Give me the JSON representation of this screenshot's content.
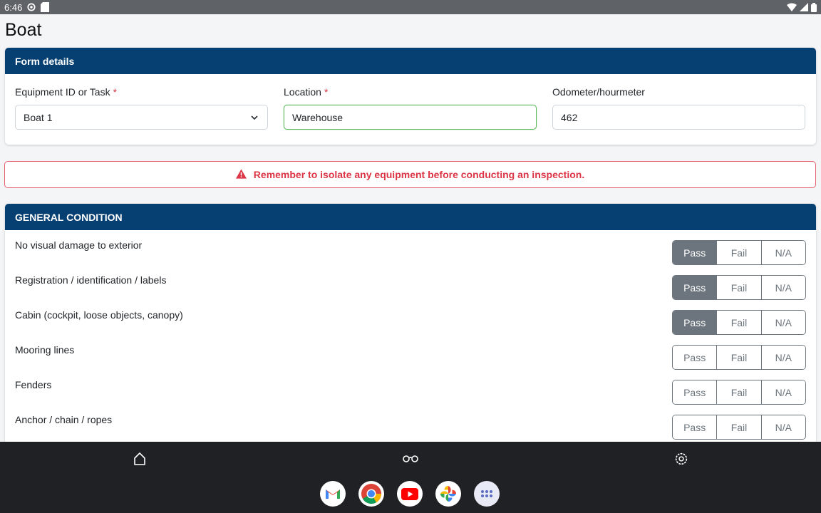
{
  "status_bar": {
    "time": "6:46",
    "left_icons": [
      "gear-icon",
      "sim-card-icon"
    ],
    "right_icons": [
      "wifi-icon",
      "signal-icon",
      "battery-icon"
    ]
  },
  "page": {
    "title": "Boat"
  },
  "form": {
    "header": "Form details",
    "equipment": {
      "label": "Equipment ID or Task",
      "required_mark": "*",
      "value": "Boat 1"
    },
    "location": {
      "label": "Location",
      "required_mark": "*",
      "value": "Warehouse"
    },
    "odometer": {
      "label": "Odometer/hourmeter",
      "value": "462"
    }
  },
  "alert": {
    "text": "Remember to isolate any equipment before conducting an inspection.",
    "color": "#dc3545"
  },
  "section": {
    "header": "GENERAL CONDITION",
    "options": [
      "Pass",
      "Fail",
      "N/A"
    ],
    "items": [
      {
        "label": "No visual damage to exterior",
        "selected": "Pass"
      },
      {
        "label": "Registration / identification / labels",
        "selected": "Pass"
      },
      {
        "label": "Cabin (cockpit, loose objects, canopy)",
        "selected": "Pass"
      },
      {
        "label": "Mooring lines",
        "selected": ""
      },
      {
        "label": "Fenders",
        "selected": ""
      },
      {
        "label": "Anchor / chain / ropes",
        "selected": ""
      }
    ]
  },
  "nav_bar": {
    "buttons": [
      "home-icon",
      "glasses-icon",
      "settings-icon"
    ],
    "dock_apps": [
      "gmail-app-icon",
      "chrome-app-icon",
      "youtube-app-icon",
      "photos-app-icon",
      "app-drawer-icon"
    ]
  },
  "colors": {
    "header_bg": "#063f72",
    "active_btn": "#6c757d",
    "focus_border": "#5cb85c"
  }
}
